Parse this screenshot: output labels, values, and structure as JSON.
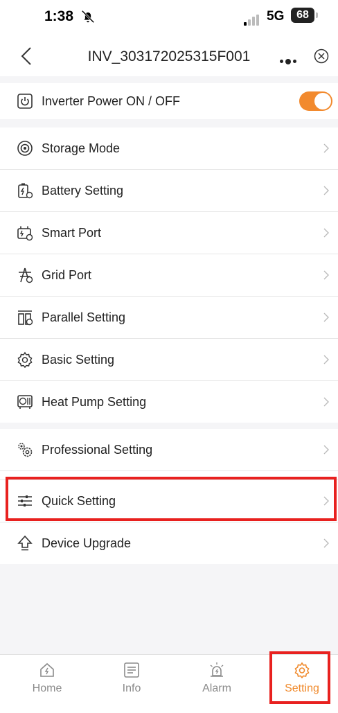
{
  "status_bar": {
    "time": "1:38",
    "network": "5G",
    "battery": "68"
  },
  "header": {
    "title": "INV_303172025315F001",
    "back_icon": "chevron-left-icon",
    "more_icon": "more-icon",
    "close_icon": "close-circle-icon"
  },
  "power": {
    "label": "Inverter Power ON / OFF",
    "state": "on",
    "accent": "#f28a2e"
  },
  "settings": [
    {
      "label": "Storage Mode",
      "icon": "storage-icon"
    },
    {
      "label": "Battery Setting",
      "icon": "battery-icon"
    },
    {
      "label": "Smart Port",
      "icon": "smart-port-icon"
    },
    {
      "label": "Grid Port",
      "icon": "grid-tower-icon"
    },
    {
      "label": "Parallel Setting",
      "icon": "parallel-icon"
    },
    {
      "label": "Basic Setting",
      "icon": "gear-icon"
    },
    {
      "label": "Heat Pump Setting",
      "icon": "heat-pump-icon"
    }
  ],
  "advanced": [
    {
      "label": "Professional Setting",
      "icon": "gears-icon"
    },
    {
      "label": "Quick Setting",
      "icon": "sliders-icon"
    },
    {
      "label": "Device Upgrade",
      "icon": "upgrade-icon"
    }
  ],
  "tabs": [
    {
      "label": "Home",
      "icon": "home-icon"
    },
    {
      "label": "Info",
      "icon": "list-icon"
    },
    {
      "label": "Alarm",
      "icon": "alarm-icon"
    },
    {
      "label": "Setting",
      "icon": "gear-icon",
      "active": true
    }
  ],
  "colors": {
    "accent": "#f08a2c",
    "highlight": "#e8211f"
  }
}
